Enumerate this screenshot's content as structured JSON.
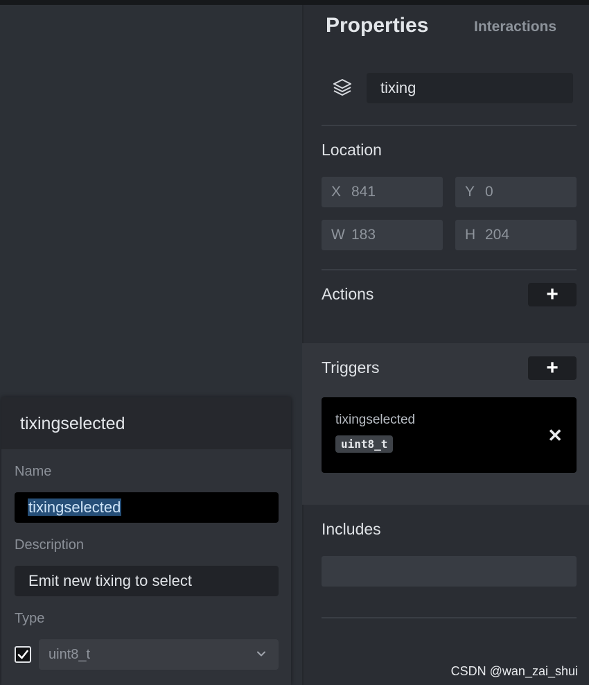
{
  "tabs": {
    "properties": "Properties",
    "interactions": "Interactions"
  },
  "widget": {
    "name": "tixing",
    "icon": "layers-icon"
  },
  "location": {
    "title": "Location",
    "x_label": "X",
    "x_value": "841",
    "y_label": "Y",
    "y_value": "0",
    "w_label": "W",
    "w_value": "183",
    "h_label": "H",
    "h_value": "204"
  },
  "actions": {
    "title": "Actions",
    "add": "+"
  },
  "triggers": {
    "title": "Triggers",
    "add": "+",
    "items": [
      {
        "name": "tixingselected",
        "type": "uint8_t",
        "remove": "✕"
      }
    ]
  },
  "includes": {
    "title": "Includes"
  },
  "edit_panel": {
    "title": "tixingselected",
    "name_label": "Name",
    "name_value": "tixingselected",
    "description_label": "Description",
    "description_value": "Emit new tixing to select",
    "type_label": "Type",
    "type_enabled": true,
    "type_value": "uint8_t"
  },
  "watermark": "CSDN @wan_zai_shui",
  "colors": {
    "background": "#2c2f35",
    "panel": "#2a2d33",
    "selection": "#264f78",
    "trigger_card": "#000000"
  }
}
